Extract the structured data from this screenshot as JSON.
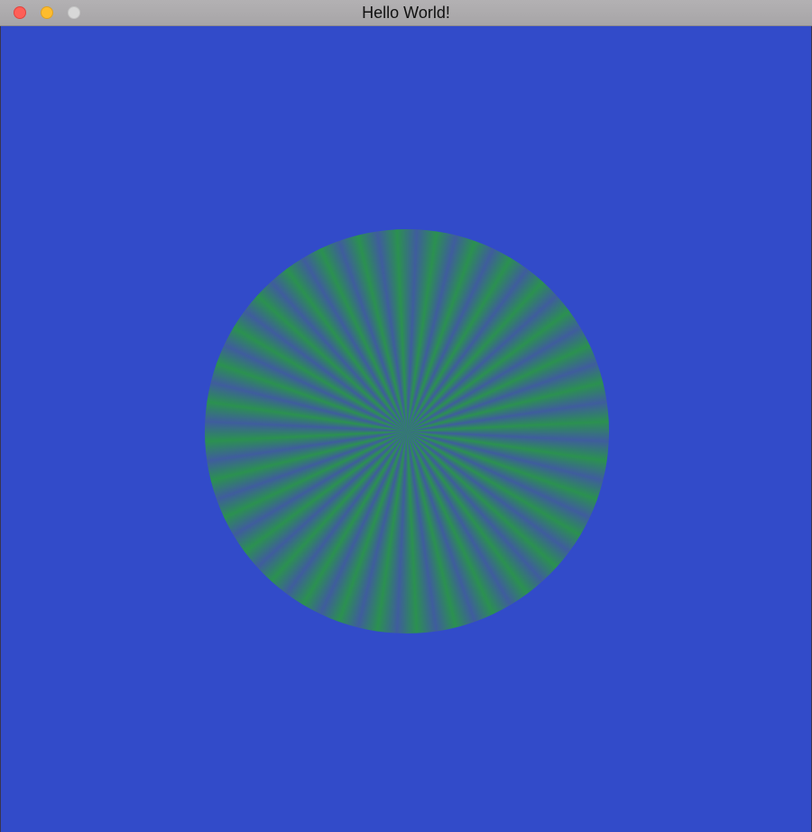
{
  "window": {
    "title": "Hello World!",
    "background_color": "#324bc9"
  },
  "traffic_lights": {
    "close_color": "#fe5f57",
    "minimize_color": "#febc2e",
    "zoom_color": "#d8d8d8"
  },
  "shape": {
    "kind": "circle with radial sunburst stripes",
    "ray_count": 32,
    "ray_color": "#2b9150",
    "gap_color": "#3f5d9d"
  }
}
